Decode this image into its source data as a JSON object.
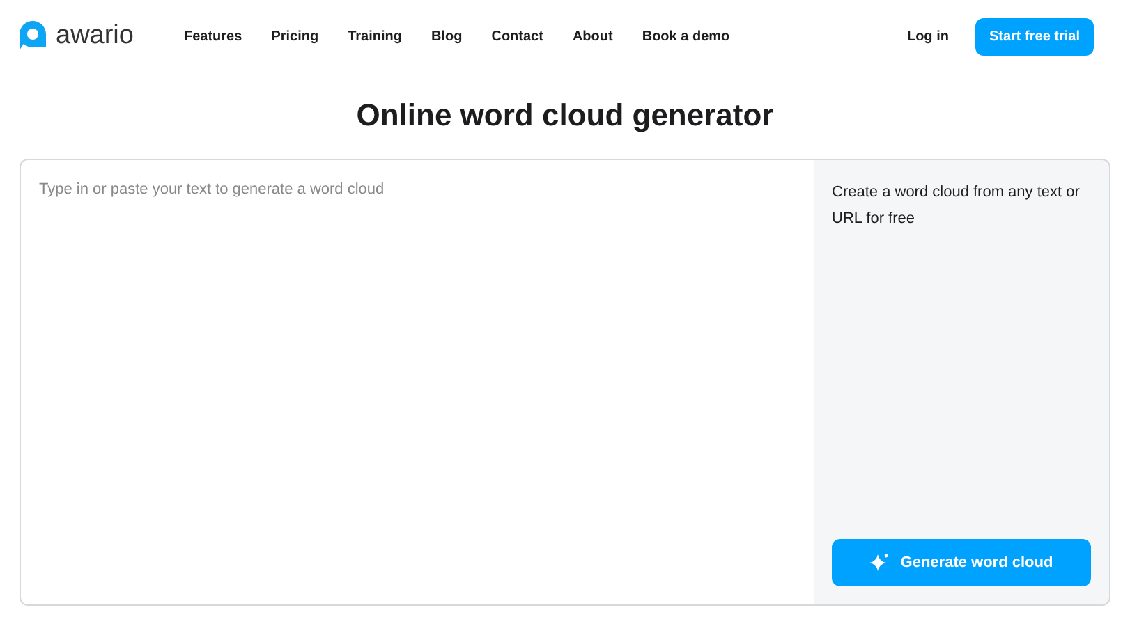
{
  "logo": {
    "text": "awario"
  },
  "nav": [
    {
      "label": "Features"
    },
    {
      "label": "Pricing"
    },
    {
      "label": "Training"
    },
    {
      "label": "Blog"
    },
    {
      "label": "Contact"
    },
    {
      "label": "About"
    },
    {
      "label": "Book a demo"
    }
  ],
  "login": "Log in",
  "trial_button": "Start free trial",
  "title": "Online word cloud generator",
  "text_area": {
    "placeholder": "Type in or paste your text to generate a word cloud"
  },
  "side_text": "Create a word cloud from any text or URL for free",
  "generate_button": "Generate word cloud"
}
